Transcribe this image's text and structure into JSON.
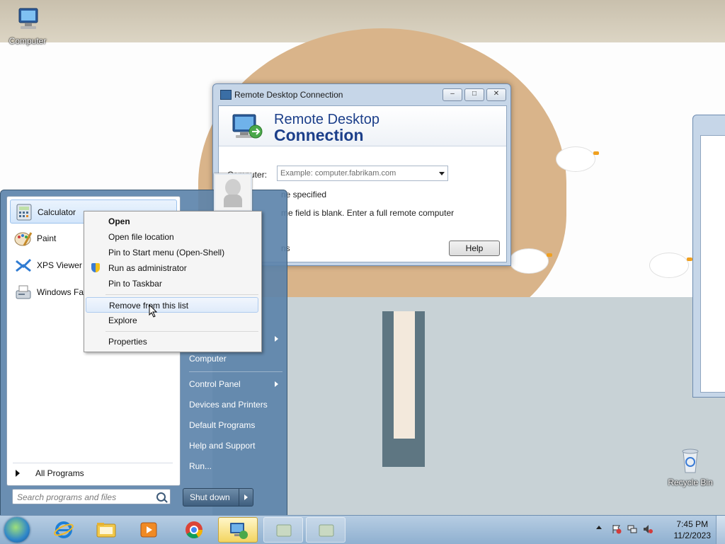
{
  "desktop": {
    "icons": [
      {
        "label": "Computer"
      },
      {
        "label": "Recycle Bin"
      }
    ]
  },
  "rdp_window": {
    "title": "Remote Desktop Connection",
    "banner_line1": "Remote Desktop",
    "banner_line2": "Connection",
    "computer_label": "Computer:",
    "computer_placeholder": "Example: computer.fabrikam.com",
    "text_line1": "ne specified",
    "text_line2": "me field is blank. Enter a full remote computer",
    "text_line3": "ns",
    "help_button": "Help",
    "btn_minimize": "–",
    "btn_maximize": "□",
    "btn_close": "✕"
  },
  "start_menu": {
    "programs": [
      {
        "label": "Calculator",
        "icon": "calculator-icon"
      },
      {
        "label": "Paint",
        "icon": "paint-icon"
      },
      {
        "label": "XPS Viewer",
        "icon": "xps-viewer-icon"
      },
      {
        "label": "Windows Fax",
        "icon": "fax-icon"
      }
    ],
    "all_programs": "All Programs",
    "search_placeholder": "Search programs and files",
    "right_items": [
      {
        "label": "Computer",
        "submenu": false
      },
      {
        "label": "Control Panel",
        "submenu": true
      },
      {
        "label": "Devices and Printers",
        "submenu": false
      },
      {
        "label": "Default Programs",
        "submenu": false
      },
      {
        "label": "Help and Support",
        "submenu": false
      },
      {
        "label": "Run...",
        "submenu": false
      }
    ],
    "shutdown": "Shut down"
  },
  "context_menu": {
    "items": [
      {
        "label": "Open",
        "bold": true
      },
      {
        "label": "Open file location"
      },
      {
        "label": "Pin to Start menu (Open-Shell)"
      },
      {
        "label": "Run as administrator",
        "icon": "shield-icon"
      },
      {
        "label": "Pin to Taskbar"
      },
      {
        "label": "Remove from this list",
        "highlighted": true
      },
      {
        "label": "Explore"
      },
      {
        "label": "Properties"
      }
    ]
  },
  "taskbar": {
    "pinned": [
      "internet-explorer-icon",
      "explorer-folder-icon",
      "media-player-icon",
      "chrome-icon",
      "remote-desktop-icon",
      "window-icon",
      "window-icon"
    ],
    "clock_time": "7:45 PM",
    "clock_date": "11/2/2023"
  },
  "colors": {
    "start_menu_bg": "#5a82aa",
    "rdp_title": "#1c3f8a",
    "taskbar": "#a2bfdc",
    "active_task": "#f3d560"
  }
}
